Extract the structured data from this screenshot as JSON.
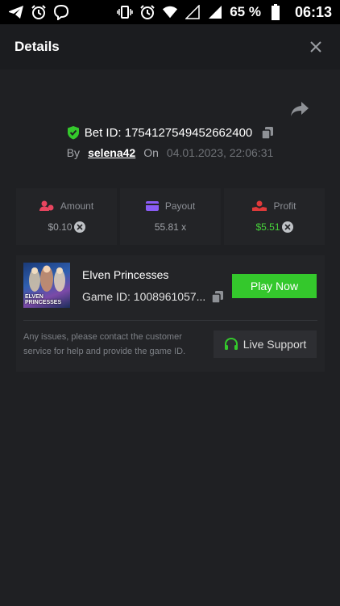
{
  "status_bar": {
    "battery": "65 %",
    "time": "06:13"
  },
  "header": {
    "title": "Details"
  },
  "bet": {
    "id_label": "Bet ID: 1754127549452662400",
    "by_label": "By",
    "username": "selena42",
    "on_label": "On",
    "date": "04.01.2023, 22:06:31"
  },
  "stats": [
    {
      "label": "Amount",
      "value": "$0.10",
      "icon": "user-coins-icon",
      "color": "#e8455f"
    },
    {
      "label": "Payout",
      "value": "55.81 x",
      "icon": "card-icon",
      "color": "#8a5cf6"
    },
    {
      "label": "Profit",
      "value": "$5.51",
      "icon": "hand-coins-icon",
      "color": "#e03a3a"
    }
  ],
  "game": {
    "thumb_title": "ELVEN PRINCESSES",
    "name": "Elven Princesses",
    "id_label": "Game ID: 1008961057...",
    "play_label": "Play Now",
    "issue_text": "Any issues, please contact the customer service for help and provide the game ID.",
    "support_label": "Live Support"
  },
  "colors": {
    "accent_green": "#34c82c",
    "profit_green": "#46d13a"
  }
}
